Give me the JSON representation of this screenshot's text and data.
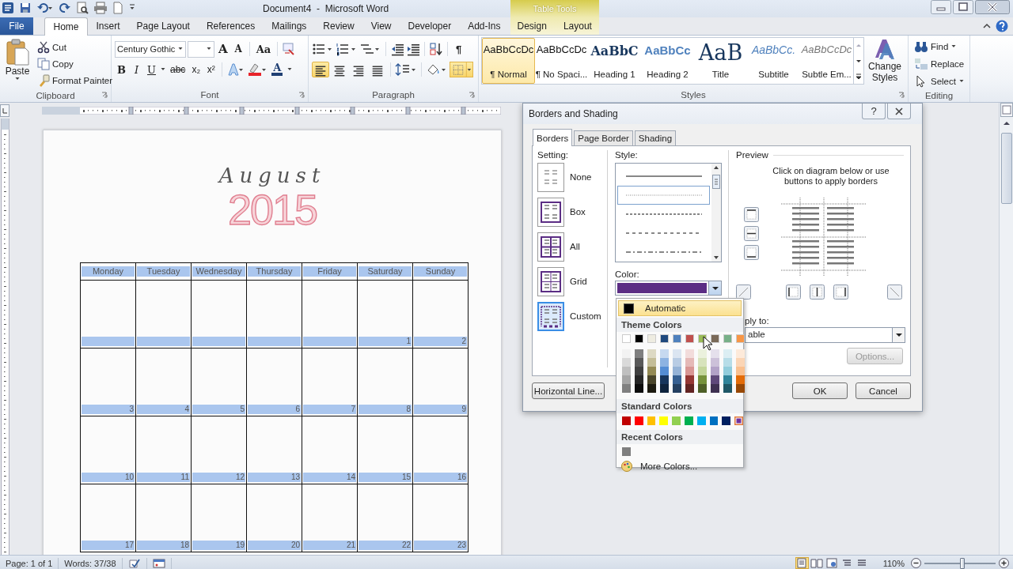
{
  "window": {
    "title": "Document4  -  Microsoft Word",
    "context_group": "Table Tools"
  },
  "ribbon_tabs": [
    {
      "label": "File",
      "kind": "file",
      "selected": false
    },
    {
      "label": "Home",
      "kind": "tab",
      "selected": true
    },
    {
      "label": "Insert",
      "kind": "tab",
      "selected": false
    },
    {
      "label": "Page Layout",
      "kind": "tab",
      "selected": false
    },
    {
      "label": "References",
      "kind": "tab",
      "selected": false
    },
    {
      "label": "Mailings",
      "kind": "tab",
      "selected": false
    },
    {
      "label": "Review",
      "kind": "tab",
      "selected": false
    },
    {
      "label": "View",
      "kind": "tab",
      "selected": false
    },
    {
      "label": "Developer",
      "kind": "tab",
      "selected": false
    },
    {
      "label": "Add-Ins",
      "kind": "tab",
      "selected": false
    },
    {
      "label": "Design",
      "kind": "context",
      "selected": false
    },
    {
      "label": "Layout",
      "kind": "context",
      "selected": false
    }
  ],
  "clipboard": {
    "label": "Clipboard",
    "paste": "Paste",
    "commands": [
      "Cut",
      "Copy",
      "Format Painter"
    ]
  },
  "font": {
    "label": "Font",
    "font_name": "Century Gothic",
    "size_buttons": [
      "A",
      "A"
    ],
    "case_button": "Aa",
    "format_buttons": [
      "B",
      "I",
      "U",
      "abc",
      "x₂",
      "x²"
    ],
    "color_button": "A"
  },
  "paragraph": {
    "label": "Paragraph",
    "pilcrow": "¶",
    "alignments": [
      {
        "kind": "left",
        "selected": true
      },
      {
        "kind": "center",
        "selected": false
      },
      {
        "kind": "right",
        "selected": false
      },
      {
        "kind": "justify",
        "selected": false
      }
    ],
    "borders_active": true
  },
  "styles": {
    "label": "Styles",
    "change_styles": "Change Styles",
    "items": [
      {
        "sample": "AaBbCcDc",
        "name": "¶ Normal",
        "kind": "normal",
        "selected": true
      },
      {
        "sample": "AaBbCcDc",
        "name": "¶ No Spaci...",
        "kind": "normal",
        "selected": false
      },
      {
        "sample": "AaBbC",
        "name": "Heading 1",
        "kind": "heading1",
        "selected": false
      },
      {
        "sample": "AaBbCc",
        "name": "Heading 2",
        "kind": "heading2",
        "selected": false
      },
      {
        "sample": "AaB",
        "name": "Title",
        "kind": "title",
        "selected": false
      },
      {
        "sample": "AaBbCc.",
        "name": "Subtitle",
        "kind": "subtitle",
        "selected": false
      },
      {
        "sample": "AaBbCcDc",
        "name": "Subtle Em...",
        "kind": "emphasis",
        "selected": false
      }
    ]
  },
  "editing": {
    "label": "Editing",
    "commands": [
      "Find",
      "Replace",
      "Select"
    ]
  },
  "document": {
    "month": "August",
    "year": "2015",
    "weekdays": [
      "Monday",
      "Tuesday",
      "Wednesday",
      "Thursday",
      "Friday",
      "Saturday",
      "Sunday"
    ],
    "weeks": [
      [
        {
          "kind": "blank"
        },
        {
          "kind": "blank"
        },
        {
          "kind": "blank"
        },
        {
          "kind": "blank"
        },
        {
          "kind": "blank"
        },
        {
          "kind": "date",
          "label": "1"
        },
        {
          "kind": "date",
          "label": "2"
        }
      ],
      [
        {
          "kind": "date",
          "label": "3"
        },
        {
          "kind": "date",
          "label": "4"
        },
        {
          "kind": "date",
          "label": "5"
        },
        {
          "kind": "date",
          "label": "6"
        },
        {
          "kind": "date",
          "label": "7"
        },
        {
          "kind": "date",
          "label": "8"
        },
        {
          "kind": "date",
          "label": "9"
        }
      ],
      [
        {
          "kind": "date",
          "label": "10"
        },
        {
          "kind": "date",
          "label": "11"
        },
        {
          "kind": "date",
          "label": "12"
        },
        {
          "kind": "date",
          "label": "13"
        },
        {
          "kind": "date",
          "label": "14"
        },
        {
          "kind": "date",
          "label": "15"
        },
        {
          "kind": "date",
          "label": "16"
        }
      ],
      [
        {
          "kind": "date",
          "label": "17"
        },
        {
          "kind": "date",
          "label": "18"
        },
        {
          "kind": "date",
          "label": "19"
        },
        {
          "kind": "date",
          "label": "20"
        },
        {
          "kind": "date",
          "label": "21"
        },
        {
          "kind": "date",
          "label": "22"
        },
        {
          "kind": "date",
          "label": "23"
        }
      ]
    ]
  },
  "dialog": {
    "title": "Borders and Shading",
    "help": "?",
    "tabs": [
      {
        "label": "Borders",
        "selected": true
      },
      {
        "label": "Page Border",
        "selected": false
      },
      {
        "label": "Shading",
        "selected": false
      }
    ],
    "setting_label": "Setting:",
    "settings": [
      {
        "label": "None",
        "kind": "none",
        "selected": false
      },
      {
        "label": "Box",
        "kind": "box",
        "selected": false
      },
      {
        "label": "All",
        "kind": "all",
        "selected": false
      },
      {
        "label": "Grid",
        "kind": "grid",
        "selected": false
      },
      {
        "label": "Custom",
        "kind": "custom",
        "selected": true
      }
    ],
    "style_label": "Style:",
    "line_styles": [
      {
        "kind": "solid",
        "selected": false
      },
      {
        "kind": "dotted",
        "selected": true
      },
      {
        "kind": "dashed",
        "selected": false
      },
      {
        "kind": "dashed-wide",
        "selected": false
      },
      {
        "kind": "dash-dot",
        "selected": false
      }
    ],
    "color_label": "Color:",
    "border_color": {
      "color": "#5b2d84"
    },
    "preview_label": "Preview",
    "preview_hint": "Click on diagram below or use buttons to apply borders",
    "apply_label": "ply to:",
    "apply_value": "able",
    "options": {
      "label": "Options...",
      "disabled": true
    },
    "horizontal_line": "Horizontal Line...",
    "ok": "OK",
    "cancel": "Cancel"
  },
  "color_menu": {
    "automatic": {
      "label": "Automatic",
      "highlighted": true
    },
    "theme_heading": "Theme Colors",
    "theme_colors": [
      {
        "color": "#ffffff",
        "shades": [
          {
            "color": "#f2f2f2"
          },
          {
            "color": "#d9d9d9"
          },
          {
            "color": "#bfbfbf"
          },
          {
            "color": "#a6a6a6"
          },
          {
            "color": "#808080"
          }
        ]
      },
      {
        "color": "#000000",
        "shades": [
          {
            "color": "#7f7f7f"
          },
          {
            "color": "#595959"
          },
          {
            "color": "#404040"
          },
          {
            "color": "#262626"
          },
          {
            "color": "#0d0d0d"
          }
        ]
      },
      {
        "color": "#eeece1",
        "shades": [
          {
            "color": "#ddd9c3"
          },
          {
            "color": "#c4bd97"
          },
          {
            "color": "#948a54"
          },
          {
            "color": "#4a452a"
          },
          {
            "color": "#1d1b10"
          }
        ]
      },
      {
        "color": "#1f497d",
        "shades": [
          {
            "color": "#c6d9f0"
          },
          {
            "color": "#8db3e2"
          },
          {
            "color": "#548dd4"
          },
          {
            "color": "#17365d"
          },
          {
            "color": "#0f243e"
          }
        ]
      },
      {
        "color": "#4f81bd",
        "shades": [
          {
            "color": "#dbe5f1"
          },
          {
            "color": "#b8cce4"
          },
          {
            "color": "#95b3d7"
          },
          {
            "color": "#366092"
          },
          {
            "color": "#244061"
          }
        ]
      },
      {
        "color": "#c0504d",
        "shades": [
          {
            "color": "#f2dcdb"
          },
          {
            "color": "#e5b9b7"
          },
          {
            "color": "#d99694"
          },
          {
            "color": "#953734"
          },
          {
            "color": "#632423"
          }
        ]
      },
      {
        "color": "#9bbb59",
        "shades": [
          {
            "color": "#ebf1dd"
          },
          {
            "color": "#d7e3bc"
          },
          {
            "color": "#c3d69b"
          },
          {
            "color": "#76923c"
          },
          {
            "color": "#4f6128"
          }
        ]
      },
      {
        "color": "#7a6a58",
        "shades": [
          {
            "color": "#e5e0ec"
          },
          {
            "color": "#ccc1d9"
          },
          {
            "color": "#b2a2c7"
          },
          {
            "color": "#5f497a"
          },
          {
            "color": "#3f3151"
          }
        ]
      },
      {
        "color": "#78b088",
        "shades": [
          {
            "color": "#dbeef3"
          },
          {
            "color": "#b7dde8"
          },
          {
            "color": "#92cddc"
          },
          {
            "color": "#31859b"
          },
          {
            "color": "#205867"
          }
        ]
      },
      {
        "color": "#f79646",
        "shades": [
          {
            "color": "#fdeada"
          },
          {
            "color": "#fbd5b5"
          },
          {
            "color": "#fac08f"
          },
          {
            "color": "#e36c09"
          },
          {
            "color": "#974806"
          }
        ]
      }
    ],
    "standard_heading": "Standard Colors",
    "standard_colors": [
      {
        "color": "#c00000",
        "selected": false
      },
      {
        "color": "#ff0000",
        "selected": false
      },
      {
        "color": "#ffc000",
        "selected": false
      },
      {
        "color": "#ffff00",
        "selected": false
      },
      {
        "color": "#92d050",
        "selected": false
      },
      {
        "color": "#00b050",
        "selected": false
      },
      {
        "color": "#00b0f0",
        "selected": false
      },
      {
        "color": "#0070c0",
        "selected": false
      },
      {
        "color": "#002060",
        "selected": false
      },
      {
        "color": "#7030a0",
        "selected": true
      }
    ],
    "recent_heading": "Recent Colors",
    "recent_colors": [
      {
        "color": "#7f7f7f"
      }
    ],
    "more": "More Colors..."
  },
  "status_bar": {
    "page": "Page: 1 of 1",
    "words": "Words: 37/38",
    "views": [
      {
        "kind": "print",
        "selected": true
      },
      {
        "kind": "reading",
        "selected": false
      },
      {
        "kind": "web",
        "selected": false
      },
      {
        "kind": "outline",
        "selected": false
      },
      {
        "kind": "draft",
        "selected": false
      }
    ],
    "zoom": "110%",
    "zoom_slider": {
      "level": 0.53
    }
  }
}
